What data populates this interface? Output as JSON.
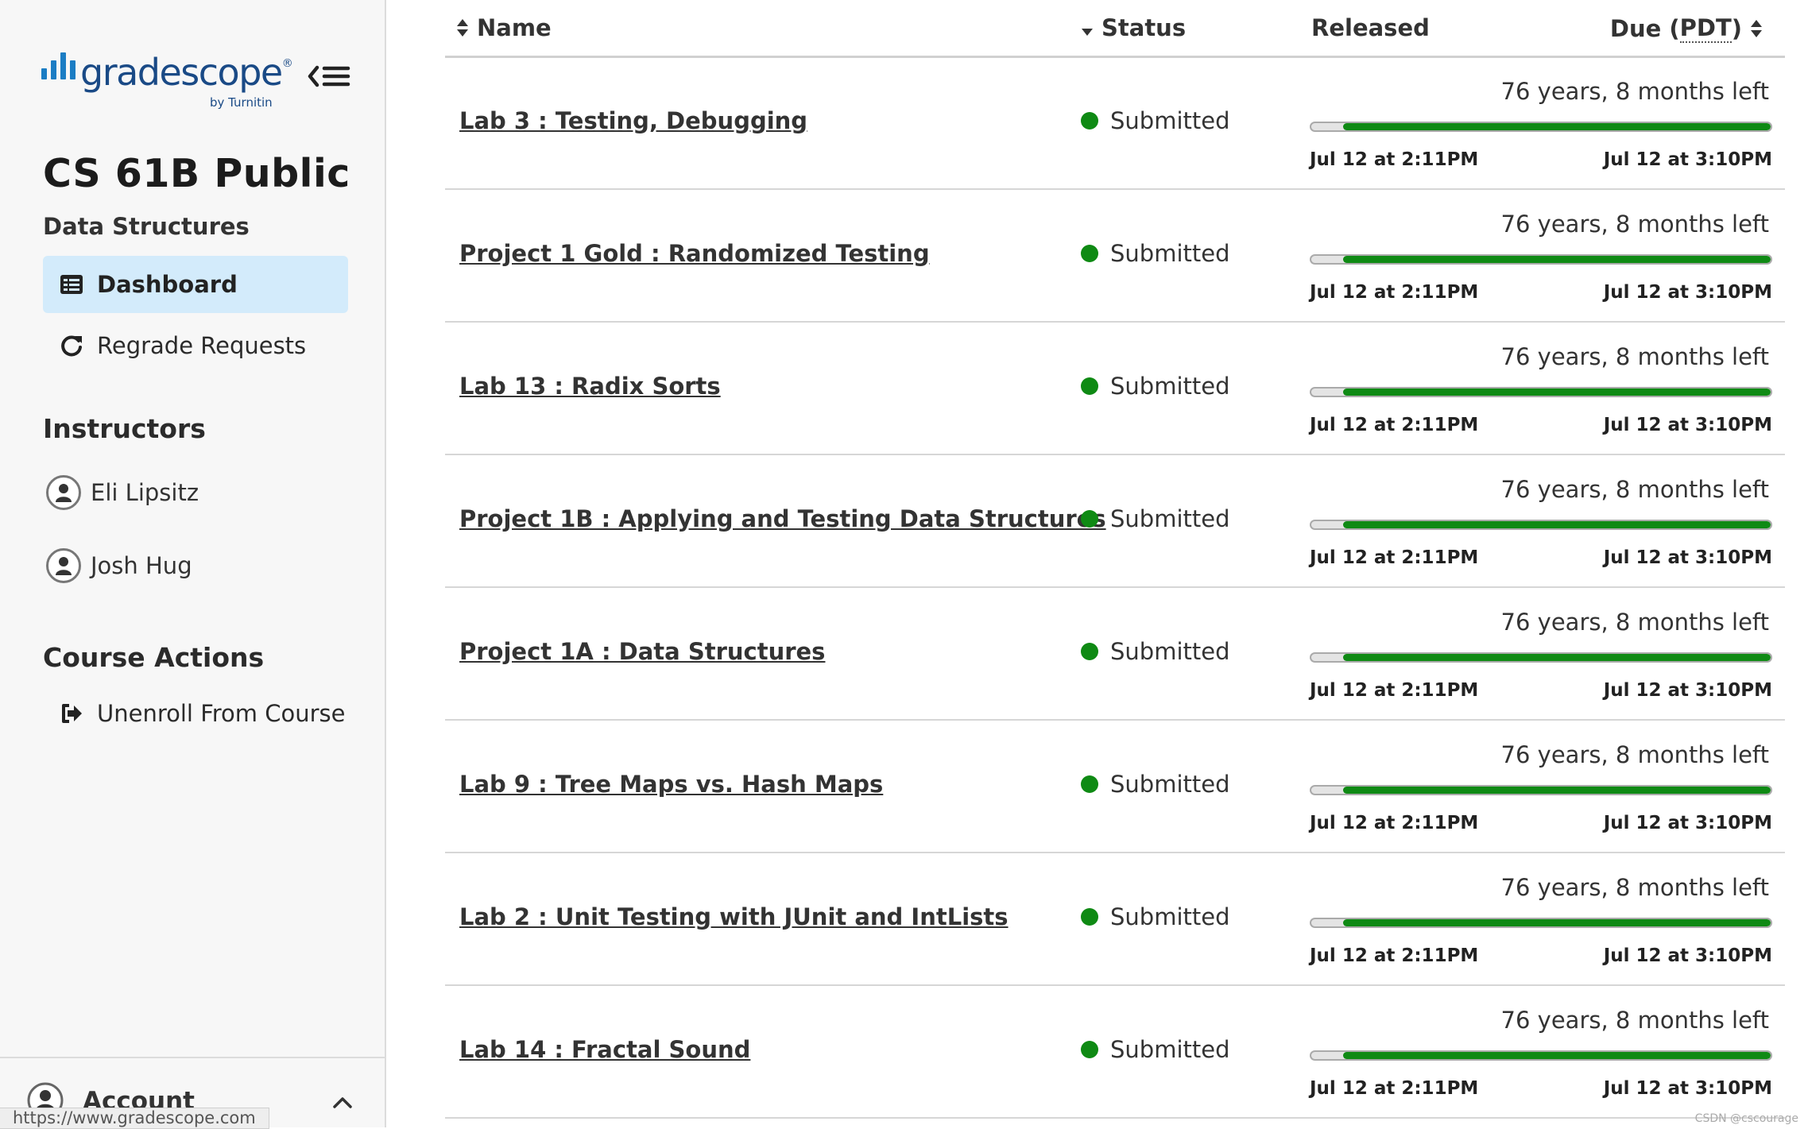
{
  "sidebar": {
    "logo": {
      "text": "gradescope",
      "registered": "®",
      "by": "by Turnitin"
    },
    "course": {
      "title": "CS 61B Public",
      "subtitle": "Data Structures"
    },
    "nav": [
      {
        "label": "Dashboard",
        "icon": "dashboard-icon",
        "active": true
      },
      {
        "label": "Regrade Requests",
        "icon": "refresh-icon",
        "active": false
      }
    ],
    "instructors_heading": "Instructors",
    "instructors": [
      {
        "name": "Eli Lipsitz",
        "icon": "user-avatar-icon"
      },
      {
        "name": "Josh Hug",
        "icon": "user-avatar-icon"
      }
    ],
    "course_actions_heading": "Course Actions",
    "course_actions": [
      {
        "label": "Unenroll From Course",
        "icon": "sign-out-icon"
      }
    ],
    "account_label": "Account",
    "status_url": "https://www.gradescope.com"
  },
  "table": {
    "columns": {
      "name": "Name",
      "status": "Status",
      "released": "Released",
      "due_prefix": "Due (",
      "due_abbr": "PDT",
      "due_suffix": ")"
    },
    "rows": [
      {
        "name": "Lab 3 : Testing, Debugging",
        "status": "Submitted",
        "time_left": "76 years, 8 months left",
        "released": "Jul 12 at 2:11PM",
        "due": "Jul 12 at 3:10PM",
        "progress_remaining": 0.93
      },
      {
        "name": "Project 1 Gold : Randomized Testing",
        "status": "Submitted",
        "time_left": "76 years, 8 months left",
        "released": "Jul 12 at 2:11PM",
        "due": "Jul 12 at 3:10PM",
        "progress_remaining": 0.93
      },
      {
        "name": "Lab 13 : Radix Sorts",
        "status": "Submitted",
        "time_left": "76 years, 8 months left",
        "released": "Jul 12 at 2:11PM",
        "due": "Jul 12 at 3:10PM",
        "progress_remaining": 0.93
      },
      {
        "name": "Project 1B : Applying and Testing Data Structures",
        "status": "Submitted",
        "time_left": "76 years, 8 months left",
        "released": "Jul 12 at 2:11PM",
        "due": "Jul 12 at 3:10PM",
        "progress_remaining": 0.93
      },
      {
        "name": "Project 1A : Data Structures",
        "status": "Submitted",
        "time_left": "76 years, 8 months left",
        "released": "Jul 12 at 2:11PM",
        "due": "Jul 12 at 3:10PM",
        "progress_remaining": 0.93
      },
      {
        "name": "Lab 9 : Tree Maps vs. Hash Maps",
        "status": "Submitted",
        "time_left": "76 years, 8 months left",
        "released": "Jul 12 at 2:11PM",
        "due": "Jul 12 at 3:10PM",
        "progress_remaining": 0.93
      },
      {
        "name": "Lab 2 : Unit Testing with JUnit and IntLists",
        "status": "Submitted",
        "time_left": "76 years, 8 months left",
        "released": "Jul 12 at 2:11PM",
        "due": "Jul 12 at 3:10PM",
        "progress_remaining": 0.93
      },
      {
        "name": "Lab 14 : Fractal Sound",
        "status": "Submitted",
        "time_left": "76 years, 8 months left",
        "released": "Jul 12 at 2:11PM",
        "due": "Jul 12 at 3:10PM",
        "progress_remaining": 0.93
      }
    ]
  },
  "colors": {
    "brand": "#1a4a86",
    "logo_bars": "#1b7dc4",
    "active_nav_bg": "#d3ebfb",
    "status_submitted": "#0f8a14",
    "progress_fill": "#0f8a14"
  },
  "watermark": "CSDN @cscourage"
}
